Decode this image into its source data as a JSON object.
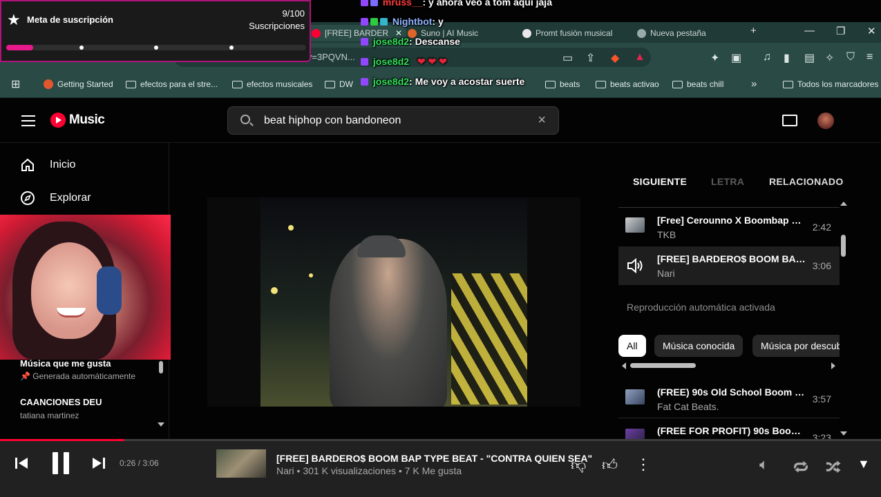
{
  "browser": {
    "tabs": [
      {
        "label": "[FREE] BARDER",
        "active": true
      },
      {
        "label": "Suno | AI Music",
        "active": false
      },
      {
        "label": "Promt fusión musical",
        "active": false
      },
      {
        "label": "Nueva pestaña",
        "active": false
      }
    ],
    "url": "music.youtube.com/watch?v=3PQVN...",
    "bookmarks": [
      "Getting Started",
      "efectos para el stre...",
      "efectos musicales",
      "DW",
      "beats",
      "beats activao",
      "beats chill"
    ],
    "bookmarks_more": "»",
    "all_bookmarks": "Todos los marcadores"
  },
  "app": {
    "logo_text": "Music",
    "search_value": "beat hiphop con bandoneon"
  },
  "sidebar": {
    "nav": [
      {
        "label": "Inicio",
        "icon": "home-icon"
      },
      {
        "label": "Explorar",
        "icon": "explore-icon"
      }
    ],
    "library": [
      {
        "title": "Música que me gusta",
        "subtitle": "Generada automáticamente"
      },
      {
        "title": "CAANCIONES DEU",
        "subtitle": "tatiana martinez"
      }
    ]
  },
  "panel": {
    "tabs": [
      "SIGUIENTE",
      "LETRA",
      "RELACIONADO"
    ],
    "queue": [
      {
        "title": "[Free] Cerounno X Boombap Ty...",
        "artist": "TKB",
        "duration": "2:42"
      },
      {
        "title": "[FREE] BARDERO$ BOOM BAP ...",
        "artist": "Nari",
        "duration": "3:06"
      }
    ],
    "autoplay": "Reproducción automática activada",
    "chips": [
      "All",
      "Música conocida",
      "Música por descubrir"
    ],
    "suggestions": [
      {
        "title": "(FREE) 90s Old School Boom Bap...",
        "artist": "Fat Cat Beats.",
        "duration": "3:57"
      },
      {
        "title": "(FREE FOR PROFIT) 90s Boom Ba...",
        "artist": "",
        "duration": "3:23"
      }
    ]
  },
  "player": {
    "progress": 0.141,
    "time": "0:26 / 3:06",
    "title": "[FREE] BARDERO$ BOOM BAP TYPE BEAT - \"CONTRA QUIEN SEA\"",
    "meta": "Nari • 301 K visualizaciones • 7 K Me gusta"
  },
  "overlay": {
    "sub_title": "Meta de suscripción",
    "sub_count": "9/100",
    "sub_label": "Suscripciones",
    "sub_progress": 0.09,
    "chat": [
      {
        "user": "mruss__",
        "message": ": y ahora veo a tom aqui jaja",
        "color": "#ff3b3b"
      },
      {
        "user": "Nightbot",
        "message": ": y",
        "color": "#8fb3ff"
      },
      {
        "user": "jose8d2",
        "message": ": Descanse",
        "color": "#33e05a"
      },
      {
        "user": "jose8d2",
        "message": "",
        "color": "#33e05a"
      },
      {
        "user": "jose8d2",
        "message": ": Me voy a acostar suerte",
        "color": "#33e05a"
      }
    ]
  },
  "colors": {
    "accent": "#ff0033",
    "sub_bar": "#e8198b",
    "sub_border": "#b0137c"
  }
}
